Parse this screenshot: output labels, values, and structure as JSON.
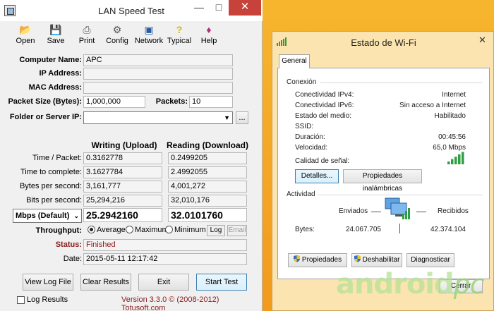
{
  "lst": {
    "title": "LAN Speed Test",
    "toolbar": [
      {
        "label": "Open",
        "icon": "folder-open-icon"
      },
      {
        "label": "Save",
        "icon": "floppy-disk-icon"
      },
      {
        "label": "Print",
        "icon": "printer-icon"
      },
      {
        "label": "Config",
        "icon": "gears-icon"
      },
      {
        "label": "Network",
        "icon": "network-icon"
      },
      {
        "label": "Typical",
        "icon": "question-icon"
      },
      {
        "label": "Help",
        "icon": "help-book-icon"
      }
    ],
    "computer_name_label": "Computer Name:",
    "computer_name_value": "APC",
    "ip_label": "IP Address:",
    "ip_value": "",
    "mac_label": "MAC Address:",
    "mac_value": "",
    "packet_size_label": "Packet Size (Bytes):",
    "packet_size_value": "1,000,000",
    "packets_label": "Packets:",
    "packets_value": "10",
    "folder_label": "Folder or Server IP:",
    "folder_value": "",
    "browse_label": "...",
    "writing_header": "Writing (Upload)",
    "reading_header": "Reading (Download)",
    "rows": [
      {
        "label": "Time / Packet:",
        "write": "0.3162778",
        "read": "0.2499205"
      },
      {
        "label": "Time to complete:",
        "write": "3.1627784",
        "read": "2.4992055"
      },
      {
        "label": "Bytes per second:",
        "write": "3,161,777",
        "read": "4,001,272"
      },
      {
        "label": "Bits per second:",
        "write": "25,294,216",
        "read": "32,010,176"
      }
    ],
    "unit_select": "Mbps (Default)",
    "mbps_write": "25.2942160",
    "mbps_read": "32.0101760",
    "throughput_label": "Throughput:",
    "throughput_options": [
      "Average",
      "Maximum",
      "Minimum"
    ],
    "throughput_selected": "Average",
    "log_button": "Log",
    "email_button": "Email",
    "status_label": "Status:",
    "status_value": "Finished",
    "date_label": "Date:",
    "date_value": "2015-05-11 12:17:42",
    "buttons": {
      "view_log": "View Log File",
      "clear": "Clear Results",
      "exit": "Exit",
      "start": "Start Test"
    },
    "log_results_label": "Log Results",
    "version_text": "Version 3.3.0  © (2008-2012) Totusoft.com",
    "colors": {
      "status_label": "#8b1a1a",
      "close": "#c7423a"
    }
  },
  "wifi": {
    "title": "Estado de Wi-Fi",
    "tab": "General",
    "conexion_title": "Conexión",
    "conexion": [
      {
        "k": "Conectividad IPv4:",
        "v": "Internet"
      },
      {
        "k": "Conectividad IPv6:",
        "v": "Sin acceso a Internet"
      },
      {
        "k": "Estado del medio:",
        "v": "Habilitado"
      },
      {
        "k": "SSID:",
        "v": ""
      },
      {
        "k": "Duración:",
        "v": "00:45:56"
      },
      {
        "k": "Velocidad:",
        "v": "65,0 Mbps"
      }
    ],
    "signal_label": "Calidad de señal:",
    "details_button": "Detalles...",
    "wireless_props_button": "Propiedades inalámbricas",
    "actividad_title": "Actividad",
    "sent_label": "Enviados",
    "received_label": "Recibidos",
    "bytes_label": "Bytes:",
    "bytes_sent": "24.067.705",
    "bytes_received": "42.374.104",
    "properties_button": "Propiedades",
    "disable_button": "Deshabilitar",
    "diagnose_button": "Diagnosticar",
    "close_button": "Cerrar",
    "signal_bars": 5
  },
  "watermark": {
    "a": "android",
    "b": "pc"
  }
}
